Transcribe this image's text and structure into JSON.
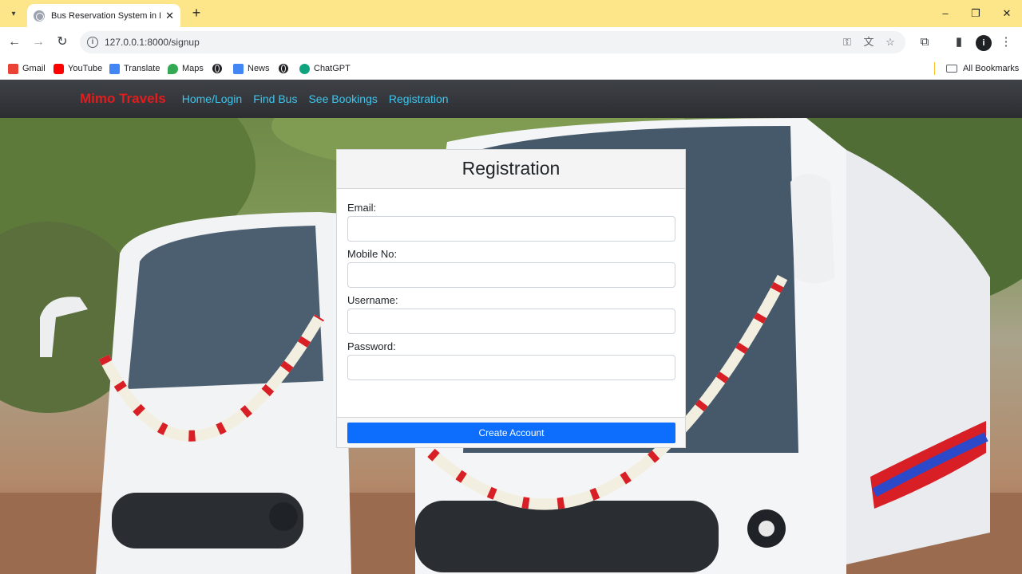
{
  "browser": {
    "tab_title": "Bus Reservation System in Djan",
    "tab_close": "✕",
    "new_tab": "+",
    "url": "127.0.0.1:8000/signup",
    "window_controls": {
      "minimize": "–",
      "restore": "❐",
      "close": "✕"
    },
    "nav": {
      "back": "←",
      "forward": "→",
      "reload": "↻"
    },
    "profile_initial": "i",
    "bookmarks": [
      {
        "label": "Gmail",
        "icon": "gmail-icon",
        "color": "#ea4335"
      },
      {
        "label": "YouTube",
        "icon": "youtube-icon",
        "color": "#ff0000"
      },
      {
        "label": "Translate",
        "icon": "translate-icon",
        "color": "#4285f4"
      },
      {
        "label": "Maps",
        "icon": "maps-icon",
        "color": "#34a853"
      },
      {
        "label": "",
        "icon": "globe-icon",
        "color": "#202124"
      },
      {
        "label": "News",
        "icon": "news-icon",
        "color": "#4285f4"
      },
      {
        "label": "",
        "icon": "globe-icon",
        "color": "#202124"
      },
      {
        "label": "ChatGPT",
        "icon": "chatgpt-icon",
        "color": "#10a37f"
      }
    ],
    "all_bookmarks": "All Bookmarks"
  },
  "navbar": {
    "brand": "Mimo Travels",
    "links": [
      "Home/Login",
      "Find Bus",
      "See Bookings",
      "Registration"
    ],
    "brand_color": "#e11d1d",
    "link_color": "#3ec6ee"
  },
  "form": {
    "title": "Registration",
    "fields": [
      {
        "label": "Email:",
        "value": ""
      },
      {
        "label": "Mobile No:",
        "value": ""
      },
      {
        "label": "Username:",
        "value": ""
      },
      {
        "label": "Password:",
        "value": ""
      }
    ],
    "submit_label": "Create Account",
    "accent": "#0d6efd"
  }
}
